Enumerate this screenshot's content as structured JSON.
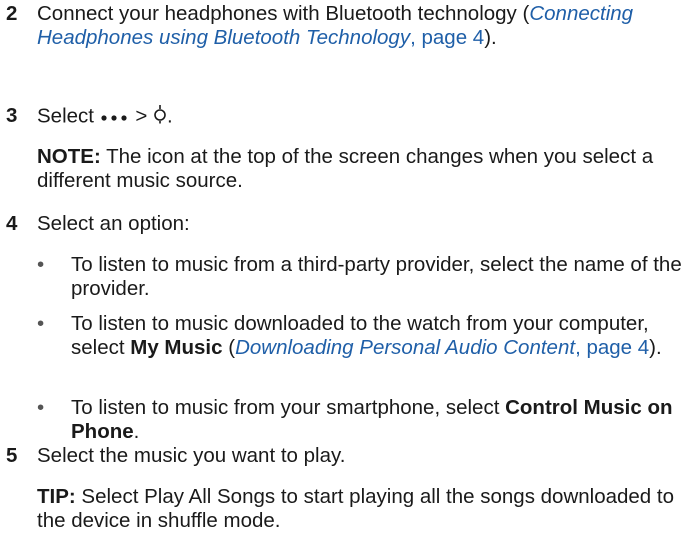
{
  "steps": [
    {
      "number": "2",
      "text_before": "Connect your headphones with Bluetooth technology (",
      "link_title": "Connecting Headphones using Bluetooth Technology",
      "link_sep": ", ",
      "link_page": "page 4",
      "text_after": ")."
    },
    {
      "number": "3",
      "text_before": "Select ",
      "text_mid": " > ",
      "text_after": ".",
      "icons": [
        "more-dots-icon",
        "music-source-icon"
      ],
      "note_label": "NOTE:",
      "note_text": " The icon at the top of the screen changes when you select a different music source."
    },
    {
      "number": "4",
      "text": "Select an option:",
      "options": [
        {
          "text": "To listen to music from a third-party provider, select the name of the provider."
        },
        {
          "text_before": "To listen to music downloaded to the watch from your computer, select ",
          "bold": "My Music",
          "text_mid": " (",
          "link_title": "Downloading Personal Audio Content",
          "link_sep": ", ",
          "link_page": "page 4",
          "text_after": ")."
        },
        {
          "text_before": "To listen to music from your smartphone, select ",
          "bold": "Control Music on Phone",
          "text_after": "."
        }
      ]
    },
    {
      "number": "5",
      "text": "Select the music you want to play.",
      "tip_label": "TIP:",
      "tip_text": " Select Play All Songs to start playing all the songs downloaded to the device in shuffle mode."
    }
  ],
  "bullet_char": "•",
  "colors": {
    "text": "#1a1a1a",
    "link": "#1f5fa8"
  }
}
